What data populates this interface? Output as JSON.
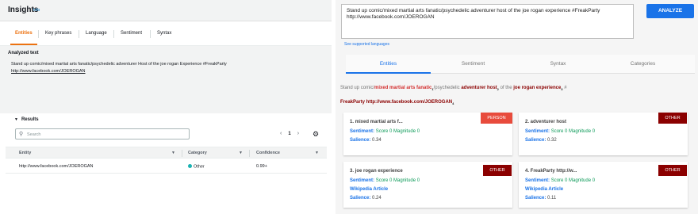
{
  "left": {
    "header": {
      "title": "Insights",
      "info": "Info"
    },
    "tabs": [
      "Entities",
      "Key phrases",
      "Language",
      "Sentiment",
      "Syntax"
    ],
    "analyzed_label": "Analyzed text",
    "analyzed_text": "Stand up comic/mixed martial arts fanatic/psychedelic adventurer Host of the joe rogan Experience #FreakParty",
    "analyzed_link": "http://www.facebook.com/JOEROGAN",
    "results": {
      "title": "Results",
      "search_placeholder": "Search",
      "page": "1",
      "columns": [
        "Entity",
        "Category",
        "Confidence"
      ],
      "rows": [
        {
          "entity": "http://www.facebook.com/JOEROGAN",
          "category": "Other",
          "confidence": "0.99+"
        }
      ]
    }
  },
  "right": {
    "input_text": "Stand up comic/mixed martial arts fanatic/psychedelic adventurer host of the joe rogan experience #FreakParty http://www.facebook.com/JOEROGAN",
    "analyze_label": "ANALYZE",
    "supported_link": "See supported languages",
    "tabs": [
      "Entities",
      "Sentiment",
      "Syntax",
      "Categories"
    ],
    "annotated": {
      "p1": "Stand up comic/",
      "e1": "mixed martial arts fanatic",
      "s1": "1",
      "p2": "/psychedelic ",
      "e2": "adventurer host",
      "s2": "2",
      "p3": " of the ",
      "e3": "joe rogan experience",
      "s3": "3",
      "p4": " #",
      "e4": "FreakParty http://www.facebook.com/JOEROGAN",
      "s4": "4"
    },
    "cards": [
      {
        "title": "1. mixed martial arts f...",
        "badge": "PERSON",
        "sentiment": "Sentiment:",
        "score": "Score 0",
        "magnitude": "Magnitude 0",
        "wiki": "",
        "salience": "Salience:",
        "salience_value": "0.34"
      },
      {
        "title": "2. adventurer host",
        "badge": "OTHER",
        "sentiment": "Sentiment:",
        "score": "Score 0",
        "magnitude": "Magnitude 0",
        "wiki": "",
        "salience": "Salience:",
        "salience_value": "0.32"
      },
      {
        "title": "3. joe rogan experience",
        "badge": "OTHER",
        "sentiment": "Sentiment:",
        "score": "Score 0",
        "magnitude": "Magnitude 0",
        "wiki": "Wikipedia Article",
        "salience": "Salience:",
        "salience_value": "0.24"
      },
      {
        "title": "4. FreakParty http://w...",
        "badge": "OTHER",
        "sentiment": "Sentiment:",
        "score": "Score 0",
        "magnitude": "Magnitude 0",
        "wiki": "Wikipedia Article",
        "salience": "Salience:",
        "salience_value": "0.11"
      }
    ],
    "colors": {
      "accent": "#1a73e8",
      "person": "#e84b3c",
      "other": "#8b0000",
      "score": "#0d9a59"
    }
  }
}
